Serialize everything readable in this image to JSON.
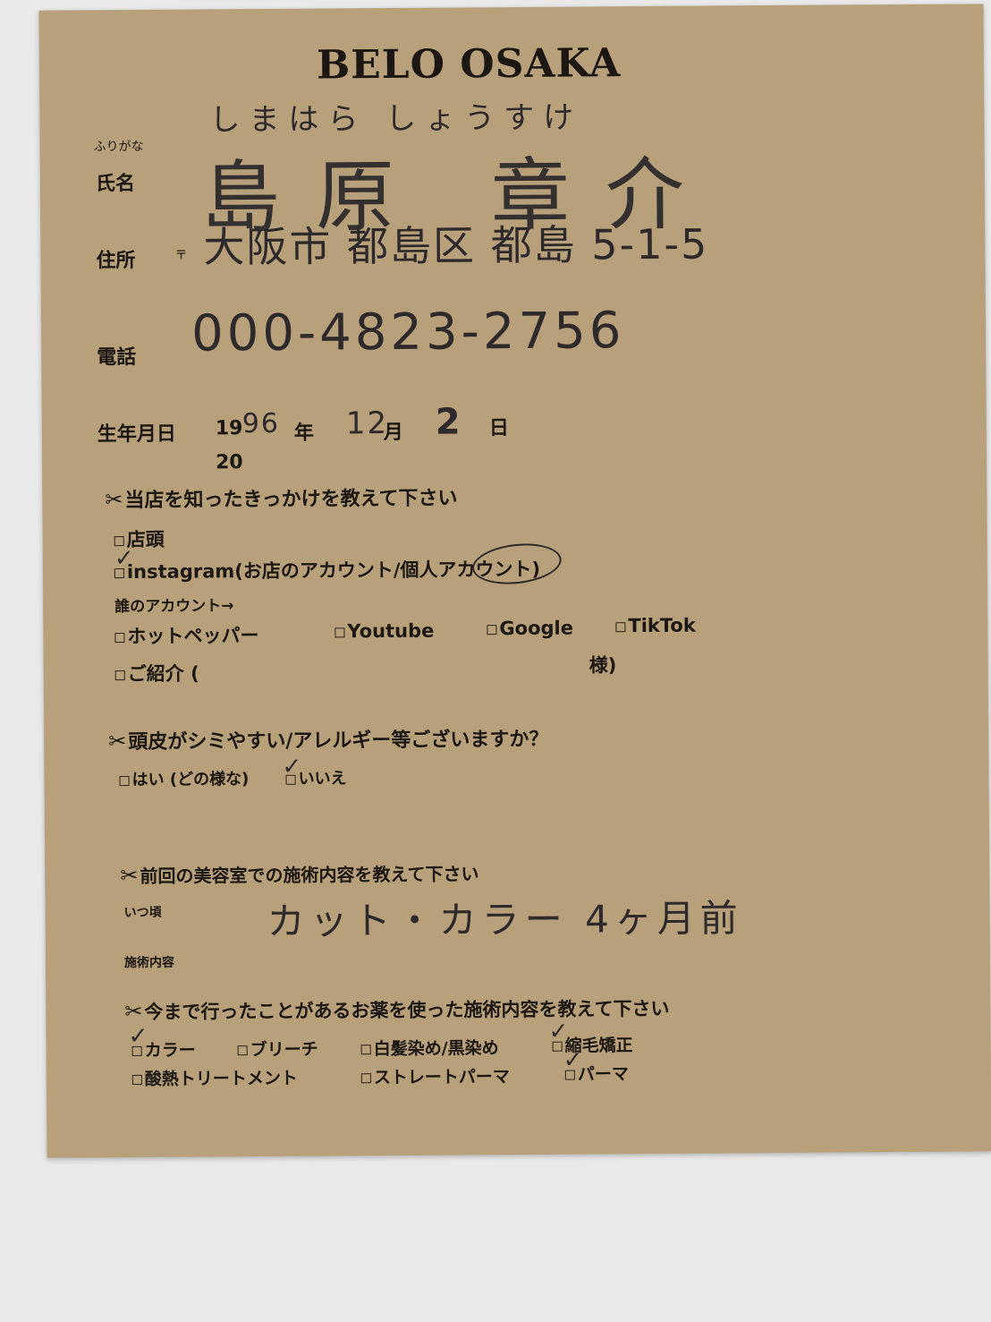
{
  "form": {
    "title": "BELO OSAKA",
    "furigana_label": "ふりがな",
    "name_label": "氏名",
    "address_label": "住所",
    "postal_mark": "〒",
    "phone_label": "電話",
    "birth_label": "生年月日",
    "year_prefix": "19",
    "year_prefix2": "20",
    "year_unit": "年",
    "month_unit": "月",
    "day_unit": "日",
    "q1": "当店を知ったきっかけを教えて下さい",
    "q1_opt_store": "店頭",
    "q1_opt_instagram": "instagram(お店のアカウント/個人アカウント)",
    "q1_whose_account": "誰のアカウント→",
    "q1_opt_hotpepper": "ホットペッパー",
    "q1_opt_youtube": "Youtube",
    "q1_opt_google": "Google",
    "q1_opt_tiktok": "TikTok",
    "q1_opt_referral": "ご紹介 (",
    "q1_referral_suffix": "様)",
    "q2": "頭皮がシミやすい/アレルギー等ございますか？",
    "q2_yes": "はい (どの様な)",
    "q2_no": "いいえ",
    "q3": "前回の美容室での施術内容を教えて下さい",
    "q3_when_label": "いつ頃",
    "q3_content_label": "施術内容",
    "q4": "今まで行ったことがあるお薬を使った施術内容を教えて下さい",
    "q4_color": "カラー",
    "q4_bleach": "ブリーチ",
    "q4_grey": "白髪染め/黒染め",
    "q4_straightening": "縮毛矯正",
    "q4_acid_heat": "酸熱トリートメント",
    "q4_straight_perm": "ストレートパーマ",
    "q4_perm": "パーマ"
  },
  "handwritten": {
    "furigana": "しまはら しょうすけ",
    "name": "島原 章介",
    "address": "大阪市 都島区 都島 5-1-5",
    "phone": "000-4823-2756",
    "birth_year": "96",
    "birth_month": "12",
    "birth_day": "2",
    "last_treatment": "カット・カラー 4ヶ月前"
  }
}
